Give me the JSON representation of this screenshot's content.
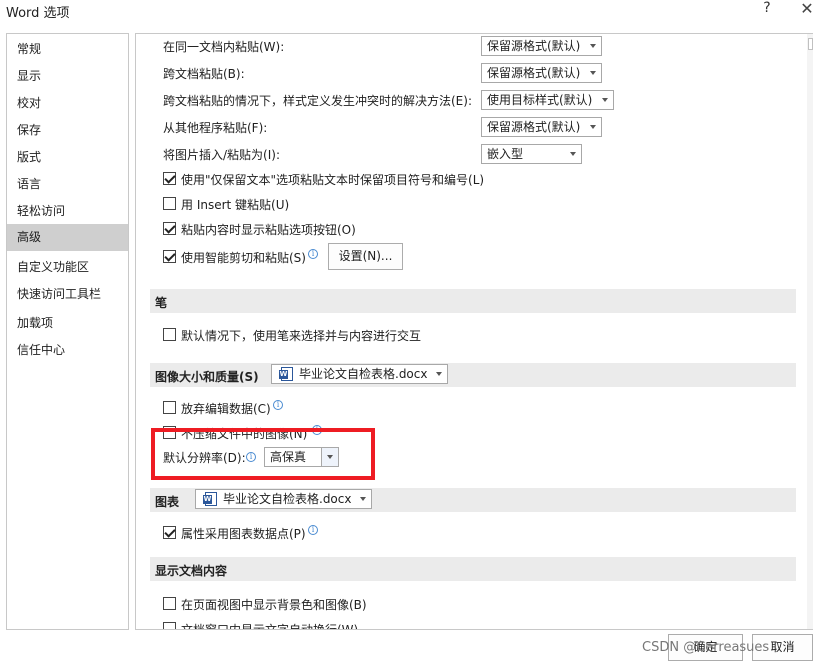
{
  "window": {
    "title": "Word 选项",
    "help": "?",
    "close": "✕"
  },
  "nav": {
    "items": [
      {
        "label": "常规"
      },
      {
        "label": "显示"
      },
      {
        "label": "校对"
      },
      {
        "label": "保存"
      },
      {
        "label": "版式"
      },
      {
        "label": "语言"
      },
      {
        "label": "轻松访问"
      },
      {
        "label": "高级",
        "active": true
      },
      {
        "label": "自定义功能区"
      },
      {
        "label": "快速访问工具栏"
      },
      {
        "label": "加载项"
      },
      {
        "label": "信任中心"
      }
    ]
  },
  "paste": {
    "same_doc_label": "在同一文档内粘贴(W):",
    "same_doc_value": "保留源格式(默认)",
    "cross_doc_label": "跨文档粘贴(B):",
    "cross_doc_value": "保留源格式(默认)",
    "cross_doc_conflict_label": "跨文档粘贴的情况下，样式定义发生冲突时的解决方法(E):",
    "cross_doc_conflict_value": "使用目标样式(默认)",
    "other_program_label": "从其他程序粘贴(F):",
    "other_program_value": "保留源格式(默认)",
    "insert_image_label": "将图片插入/粘贴为(I):",
    "insert_image_value": "嵌入型",
    "keep_text_only_label": "使用\"仅保留文本\"选项粘贴文本时保留项目符号和编号(L)",
    "insert_key_label": "用 Insert 键粘贴(U)",
    "show_paste_options_label": "粘贴内容时显示粘贴选项按钮(O)",
    "smart_cut_label": "使用智能剪切和粘贴(S)",
    "settings_button": "设置(N)..."
  },
  "pen": {
    "section_title": "笔",
    "pen_default_label": "默认情况下，使用笔来选择并与内容进行交互"
  },
  "image": {
    "section_title": "图像大小和质量(S)",
    "doc_name": "毕业论文自检表格.docx",
    "discard_edit_label": "放弃编辑数据(C)",
    "no_compress_label": "不压缩文件中的图像(N)",
    "default_resolution_label": "默认分辨率(D):",
    "default_resolution_value": "高保真"
  },
  "chart": {
    "section_title": "图表",
    "doc_name": "毕业论文自检表格.docx",
    "properties_follow_label": "属性采用图表数据点(P)"
  },
  "display": {
    "section_title": "显示文档内容",
    "show_bg_label": "在页面视图中显示背景色和图像(B)",
    "wrap_text_label": "文档窗口内显示文字自动换行(W)"
  },
  "footer": {
    "ok": "确定",
    "cancel": "取消",
    "watermark": "CSDN @Cerreasues"
  },
  "info_glyph": "i"
}
